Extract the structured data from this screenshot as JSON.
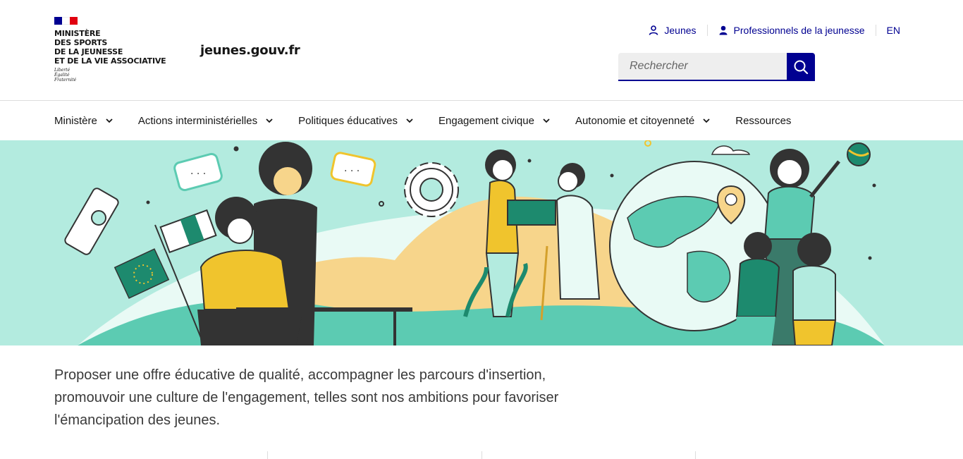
{
  "header": {
    "ministry": "Ministère\ndes sports\nde la jeunesse\net de la vie associative",
    "motto": "Liberté\nÉgalité\nFraternité",
    "site_name": "jeunes.gouv.fr",
    "quick_links": [
      {
        "label": "Jeunes",
        "icon": "user-outline-icon"
      },
      {
        "label": "Professionnels de la jeunesse",
        "icon": "user-filled-icon"
      },
      {
        "label": "EN",
        "icon": ""
      }
    ],
    "search": {
      "placeholder": "Rechercher",
      "value": ""
    }
  },
  "nav": {
    "items": [
      {
        "label": "Ministère",
        "has_dropdown": true
      },
      {
        "label": "Actions interministérielles",
        "has_dropdown": true
      },
      {
        "label": "Politiques éducatives",
        "has_dropdown": true
      },
      {
        "label": "Engagement civique",
        "has_dropdown": true
      },
      {
        "label": "Autonomie et citoyenneté",
        "has_dropdown": true
      },
      {
        "label": "Ressources",
        "has_dropdown": false
      }
    ]
  },
  "intro": {
    "text": "Proposer une offre éducative de qualité, accompagner les parcours d'insertion, promouvoir une culture de l'engagement, telles sont nos ambitions pour favoriser l'émancipation des jeunes."
  },
  "colors": {
    "brand_blue": "#000091",
    "marianne_red": "#e1000f",
    "hero_mint": "#b3ebdf",
    "hero_green": "#5ccbb2",
    "hero_sand": "#f7d58b",
    "hero_yellow": "#f0c42d",
    "hero_dark": "#333333"
  }
}
